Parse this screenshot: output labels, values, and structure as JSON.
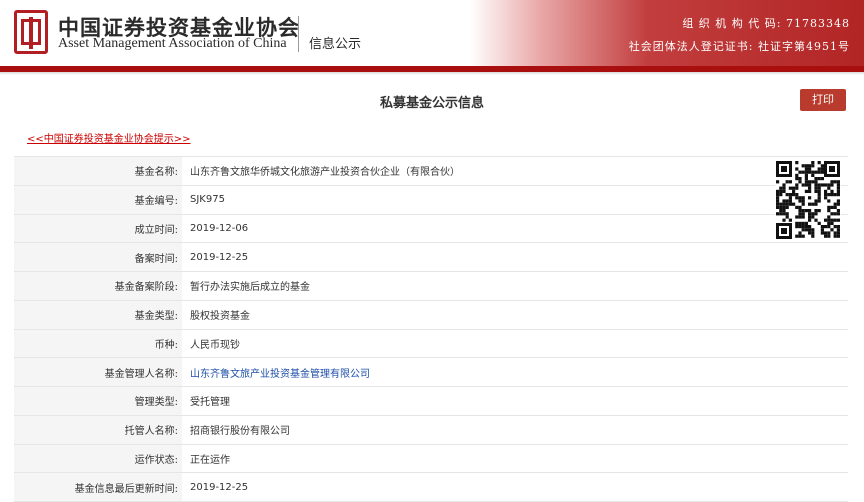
{
  "header": {
    "org_name_cn": "中国证券投资基金业协会",
    "org_name_en": "Asset Management Association of China",
    "site_title": "信息公示",
    "org_code_line": "组 织 机 构 代 码: 71783348",
    "reg_cert_line": "社会团体法人登记证书: 社证字第4951号"
  },
  "page": {
    "title": "私募基金公示信息",
    "print_label": "打印",
    "tip_link": "<<中国证券投资基金业协会提示>>"
  },
  "fund": {
    "rows": [
      {
        "label": "基金名称:",
        "value": "山东齐鲁文旅华侨城文化旅游产业投资合伙企业（有限合伙）"
      },
      {
        "label": "基金编号:",
        "value": "SJK975"
      },
      {
        "label": "成立时间:",
        "value": "2019-12-06"
      },
      {
        "label": "备案时间:",
        "value": "2019-12-25"
      },
      {
        "label": "基金备案阶段:",
        "value": "暂行办法实施后成立的基金"
      },
      {
        "label": "基金类型:",
        "value": "股权投资基金"
      },
      {
        "label": "币种:",
        "value": "人民币现钞"
      },
      {
        "label": "基金管理人名称:",
        "value": "山东齐鲁文旅产业投资基金管理有限公司"
      },
      {
        "label": "管理类型:",
        "value": "受托管理"
      },
      {
        "label": "托管人名称:",
        "value": "招商银行股份有限公司"
      },
      {
        "label": "运作状态:",
        "value": "正在运作"
      },
      {
        "label": "基金信息最后更新时间:",
        "value": "2019-12-25"
      }
    ]
  },
  "colors": {
    "brand_red": "#a90f0f",
    "print_button": "#b93b2e",
    "link_blue": "#1e4ea8",
    "tip_red": "#cc0000"
  },
  "icons": {
    "logo": "amac-logo-icon",
    "qr": "qr-code-icon"
  }
}
